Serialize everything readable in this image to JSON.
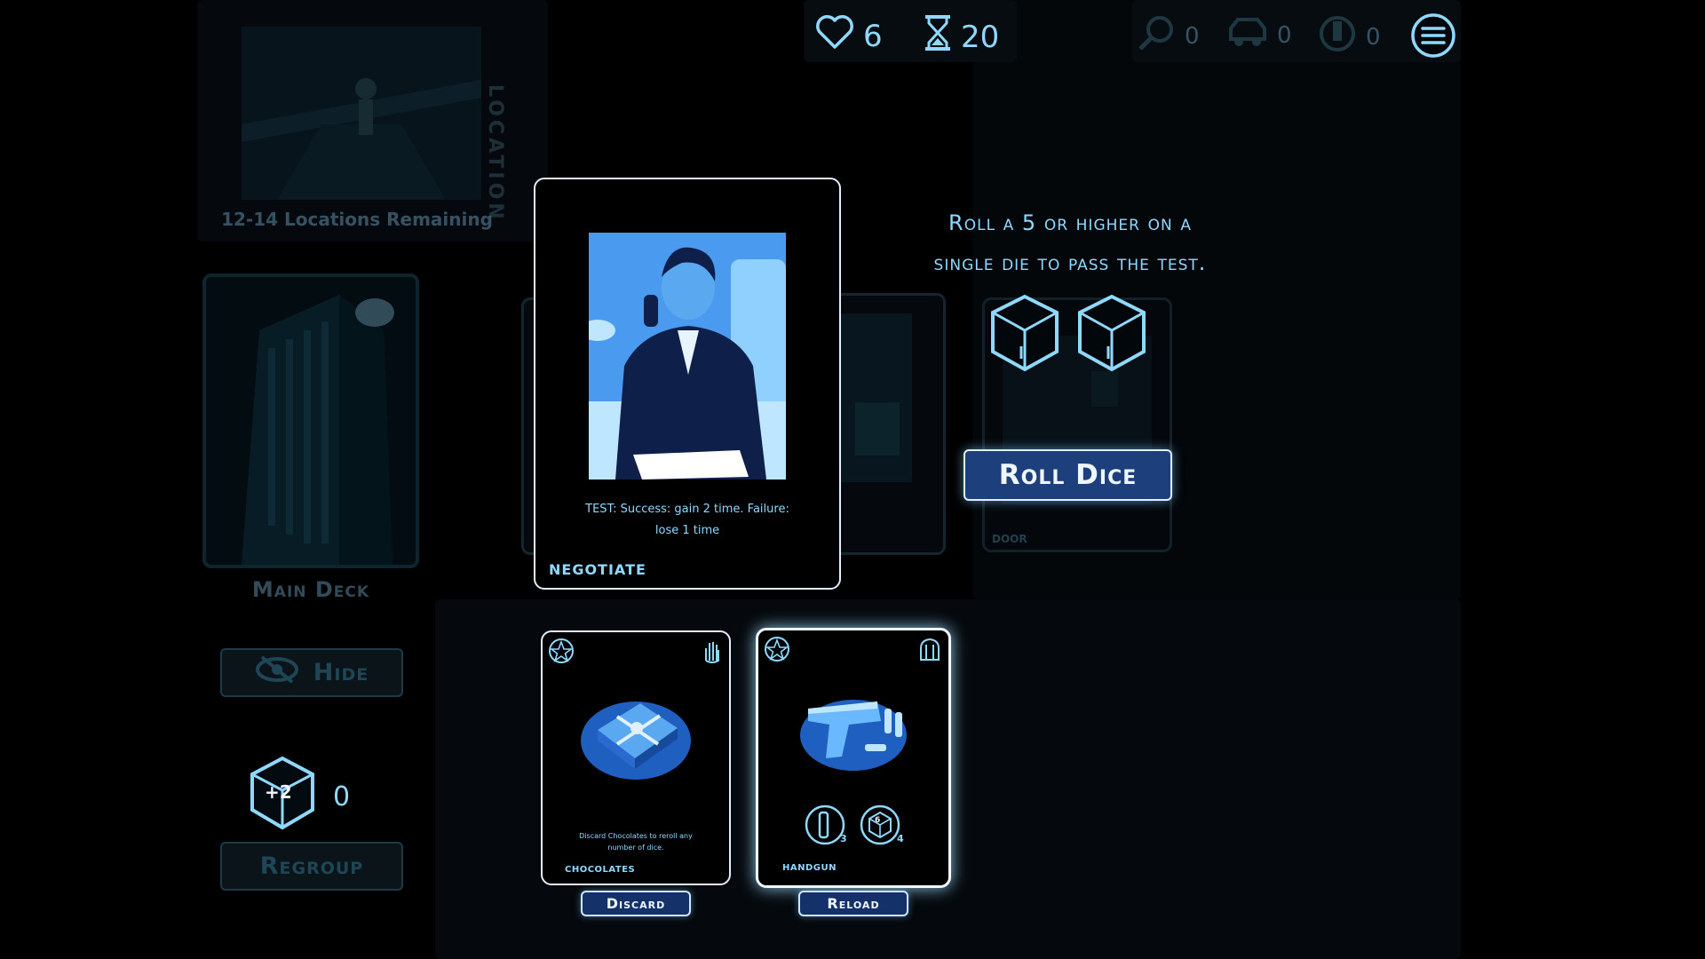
{
  "stats": {
    "lives": "6",
    "time": "20",
    "clues": "0",
    "vehicles": "0",
    "keys": "0"
  },
  "location": {
    "remaining_label": "12-14 Locations Remaining",
    "side_label": "LOCATION"
  },
  "main_deck": {
    "label": "Main Deck"
  },
  "buttons": {
    "hide": "Hide",
    "regroup": "Regroup",
    "roll_dice": "Roll Dice",
    "discard": "Discard",
    "reload": "Reload"
  },
  "regroup_bonus": {
    "dice_label": "+2",
    "count": "0"
  },
  "test": {
    "instruction_line1": "Roll a 5 or higher on a",
    "instruction_line2": "single die to pass the test."
  },
  "active_card": {
    "name": "NEGOTIATE",
    "text_line1": "TEST: Success: gain 2 time. Failure:",
    "text_line2": "lose 1 time"
  },
  "ghost_cards": {
    "door_label": "DOOR"
  },
  "hand": [
    {
      "name": "CHOCOLATES",
      "text_line1": "Discard Chocolates to reroll any",
      "text_line2": "number of dice.",
      "action": "Discard"
    },
    {
      "name": "HANDGUN",
      "ammo": "3",
      "dice": "4",
      "dice_face": "6",
      "action": "Reload"
    }
  ],
  "colors": {
    "accent": "#8fd8ff",
    "card_art": "#3a8fe6",
    "button": "#1d3f7c"
  }
}
